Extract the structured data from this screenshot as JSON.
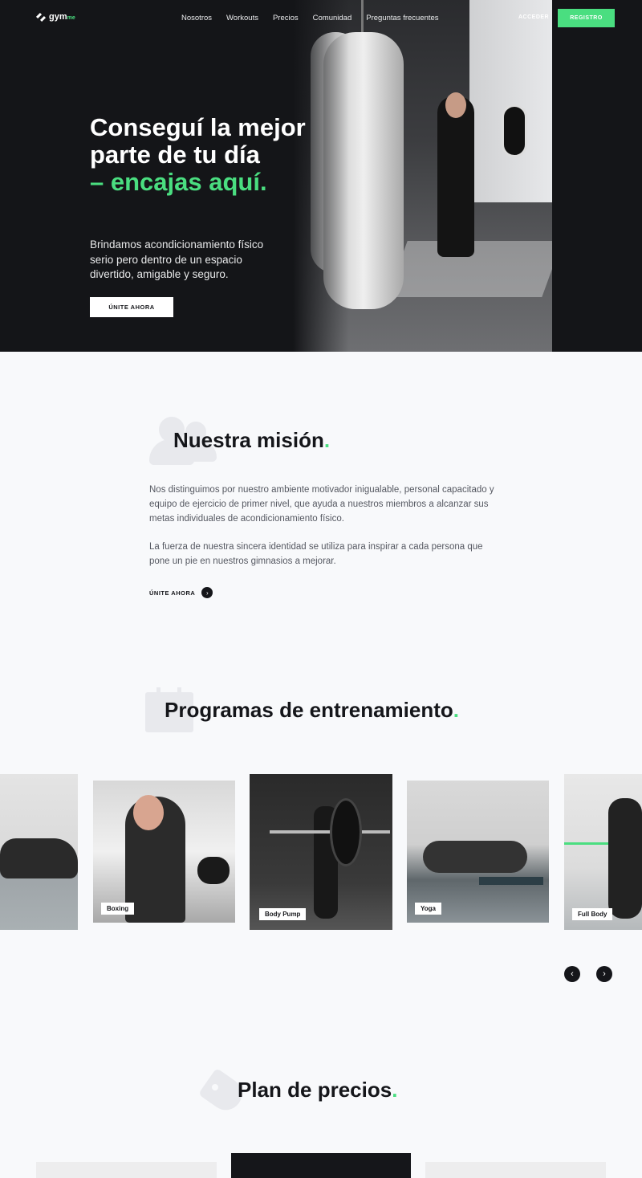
{
  "brand": {
    "logo_text": "gym",
    "logo_suffix": "me",
    "accent_color": "#4ade80"
  },
  "nav": {
    "links": [
      "Nosotros",
      "Workouts",
      "Precios",
      "Comunidad",
      "Preguntas frecuentes"
    ],
    "login_label": "ACCEDER",
    "register_label": "REGISTRO"
  },
  "hero": {
    "title_line": "Conseguí la mejor parte de tu día",
    "title_accent": "– encajas aquí.",
    "subtitle": "Brindamos acondicionamiento físico serio pero dentro de un espacio divertido, amigable y seguro.",
    "cta_label": "ÚNITE AHORA"
  },
  "mission": {
    "title": "Nuestra misión",
    "title_dot": ".",
    "paragraph1": "Nos distinguimos por nuestro ambiente motivador inigualable, personal capacitado y equipo de ejercicio de primer nivel, que ayuda a nuestros miembros a alcanzar sus metas individuales de acondicionamiento físico.",
    "paragraph2": "La fuerza de nuestra sincera identidad se utiliza para inspirar a cada persona que pone un pie en nuestros gimnasios a mejorar.",
    "cta_label": "ÚNITE AHORA"
  },
  "programs": {
    "title": "Programas de entrenamiento",
    "title_dot": ".",
    "cards": [
      {
        "label": "Boxing"
      },
      {
        "label": "Body Pump"
      },
      {
        "label": "Yoga"
      },
      {
        "label": "Full Body"
      }
    ]
  },
  "pricing": {
    "title": "Plan de precios",
    "title_dot": "."
  }
}
